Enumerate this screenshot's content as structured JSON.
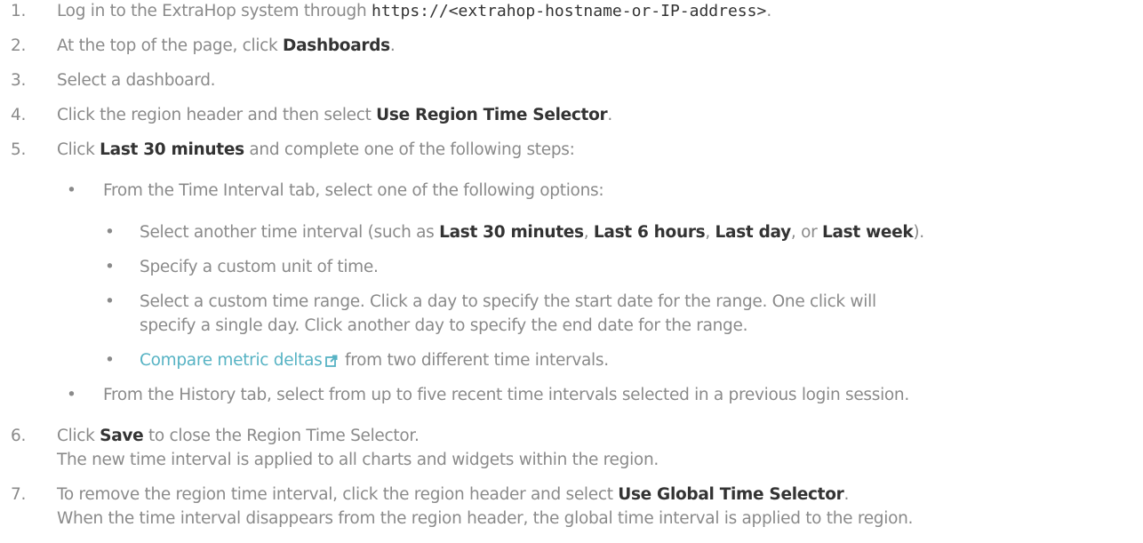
{
  "steps": [
    {
      "num": "1.",
      "pre": "Log in to the ExtraHop system through ",
      "code": "https://<extrahop-hostname-or-IP-address>",
      "post": "."
    },
    {
      "num": "2.",
      "pre": "At the top of the page, click ",
      "bold": "Dashboards",
      "post": "."
    },
    {
      "num": "3.",
      "text": "Select a dashboard."
    },
    {
      "num": "4.",
      "pre": "Click the region header and then select ",
      "bold": "Use Region Time Selector",
      "post": "."
    },
    {
      "num": "5.",
      "pre": "Click ",
      "bold": "Last 30 minutes",
      "post": " and complete one of the following steps:"
    },
    {
      "num": "6.",
      "pre": "Click ",
      "bold": "Save",
      "post": " to close the Region Time Selector.",
      "line2": "The new time interval is applied to all charts and widgets within the region."
    },
    {
      "num": "7.",
      "pre": "To remove the region time interval, click the region header and select ",
      "bold": "Use Global Time Selector",
      "post": ".",
      "line2": "When the time interval disappears from the region header, the global time interval is applied to the region."
    }
  ],
  "sub": {
    "time_interval_tab": "From the Time Interval tab, select one of the following options:",
    "opt1": {
      "pre": "Select another time interval (such as ",
      "b1": "Last 30 minutes",
      "s1": ", ",
      "b2": "Last 6 hours",
      "s2": ", ",
      "b3": "Last day",
      "s3": ", or ",
      "b4": "Last week",
      "post": ")."
    },
    "opt2": "Specify a custom unit of time.",
    "opt3": {
      "line1": "Select a custom time range. Click a day to specify the start date for the range. One click will",
      "line2": "specify a single day. Click another day to specify the end date for the range."
    },
    "opt4": {
      "link": "Compare metric deltas",
      "post": " from two different time intervals."
    },
    "history_tab": "From the History tab, select from up to five recent time intervals selected in a previous login session."
  },
  "bullet": "•",
  "icons": {
    "external": "external-link-icon"
  },
  "colors": {
    "text": "#8a8a8a",
    "bold": "#333333",
    "link": "#57b3c4"
  }
}
